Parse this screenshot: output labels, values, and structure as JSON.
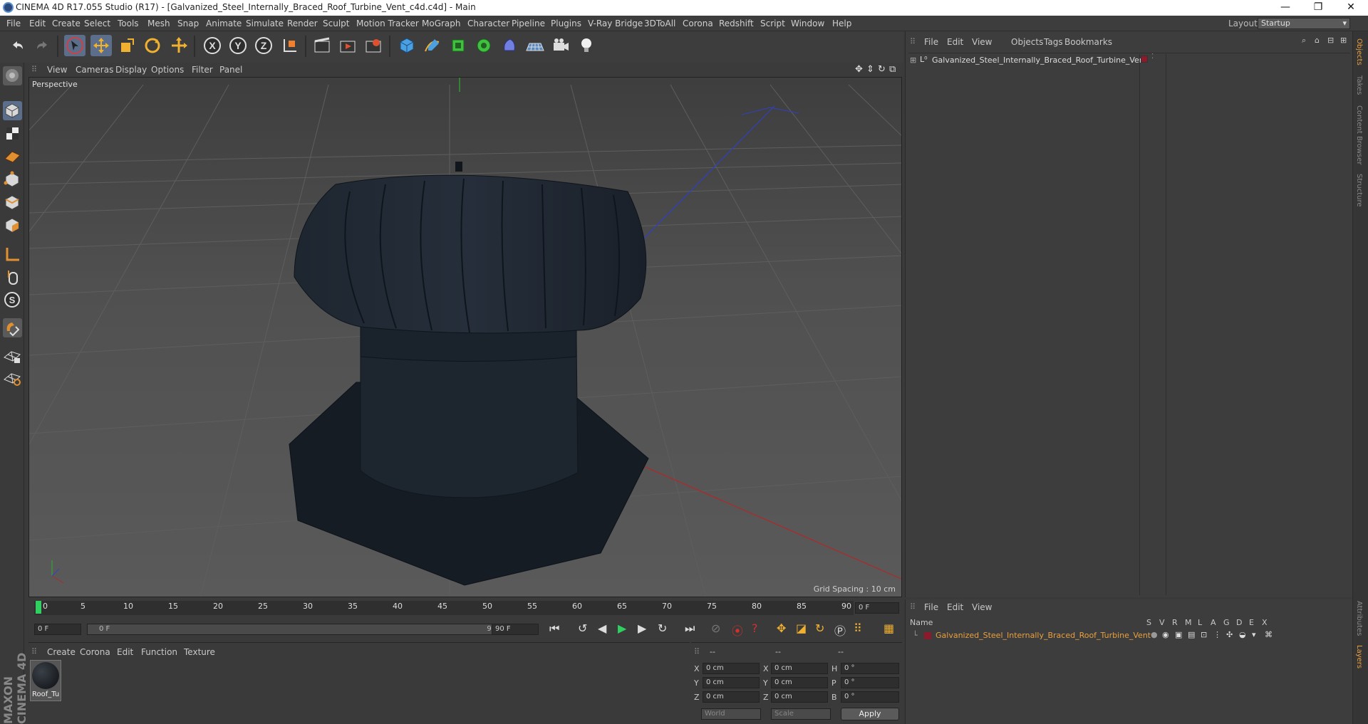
{
  "window": {
    "title": "CINEMA 4D R17.055 Studio (R17) - [Galvanized_Steel_Internally_Braced_Roof_Turbine_Vent_c4d.c4d] - Main",
    "minimize": "—",
    "maximize": "❐",
    "close": "✕"
  },
  "menubar": {
    "items": [
      "File",
      "Edit",
      "Create",
      "Select",
      "Tools",
      "Mesh",
      "Snap",
      "Animate",
      "Simulate",
      "Render",
      "Sculpt",
      "Motion Tracker",
      "MoGraph",
      "Character",
      "Pipeline",
      "Plugins",
      "V-Ray Bridge",
      "3DToAll",
      "Corona",
      "Redshift",
      "Script",
      "Window",
      "Help"
    ],
    "layout_label": "Layout:",
    "layout_value": "Startup"
  },
  "viewport": {
    "menu": [
      "View",
      "Cameras",
      "Display",
      "Options",
      "Filter",
      "Panel"
    ],
    "label": "Perspective",
    "grid_spacing": "Grid Spacing : 10 cm"
  },
  "timeline": {
    "ticks": [
      "0",
      "5",
      "10",
      "15",
      "20",
      "25",
      "30",
      "35",
      "40",
      "45",
      "50",
      "55",
      "60",
      "65",
      "70",
      "75",
      "80",
      "85",
      "90"
    ],
    "current_frame": "0 F",
    "start_field": "0 F",
    "slider_start": "0 F",
    "slider_end": "90 F",
    "end_field": "90 F"
  },
  "materials": {
    "menu": [
      "Create",
      "Corona",
      "Edit",
      "Function",
      "Texture"
    ],
    "items": [
      {
        "name": "Roof_Tu"
      }
    ]
  },
  "coordinates": {
    "headers": [
      "--",
      "--",
      "--"
    ],
    "rows": [
      {
        "a": "X",
        "av": "0 cm",
        "b": "X",
        "bv": "0 cm",
        "c": "H",
        "cv": "0 °"
      },
      {
        "a": "Y",
        "av": "0 cm",
        "b": "Y",
        "bv": "0 cm",
        "c": "P",
        "cv": "0 °"
      },
      {
        "a": "Z",
        "av": "0 cm",
        "b": "Z",
        "bv": "0 cm",
        "c": "B",
        "cv": "0 °"
      }
    ],
    "mode": "World",
    "type": "Scale",
    "apply": "Apply"
  },
  "objects_panel": {
    "menu": [
      "File",
      "Edit",
      "View",
      "Objects",
      "Tags",
      "Bookmarks"
    ],
    "object_name": "Galvanized_Steel_Internally_Braced_Roof_Turbine_Vent"
  },
  "layers_panel": {
    "menu": [
      "File",
      "Edit",
      "View"
    ],
    "name_header": "Name",
    "columns": [
      "S",
      "V",
      "R",
      "M",
      "L",
      "A",
      "G",
      "D",
      "E",
      "X"
    ],
    "layer_name": "Galvanized_Steel_Internally_Braced_Roof_Turbine_Vent"
  },
  "right_tabs": [
    "Objects",
    "Takes",
    "Content Browser",
    "Structure"
  ],
  "right_tabs_bottom": [
    "Attributes",
    "Layers"
  ],
  "brand": "MAXON CINEMA 4D",
  "colors": {
    "accent": "#5b6f8d",
    "object_name_orange": "#e8a040",
    "layer_red": "#8b1a2a",
    "axis_x": "#c83030",
    "axis_y": "#30c030",
    "axis_z": "#3050c8"
  }
}
